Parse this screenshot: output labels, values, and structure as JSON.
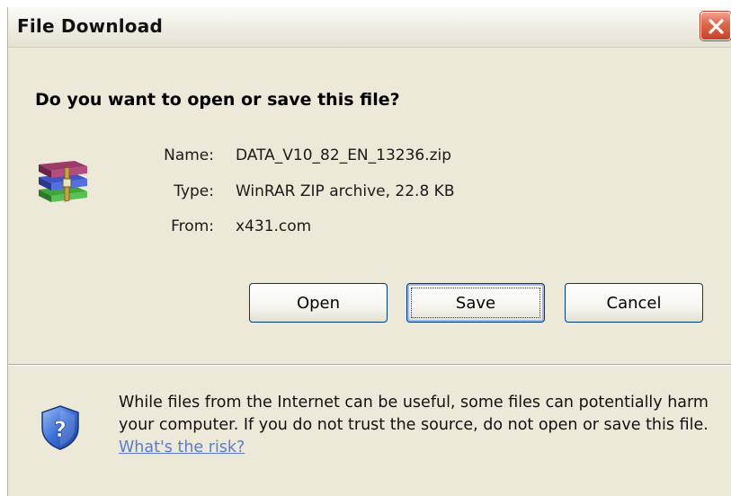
{
  "window": {
    "title": "File Download"
  },
  "question": "Do you want to open or save this file?",
  "file": {
    "name_label": "Name:",
    "name_value": "DATA_V10_82_EN_13236.zip",
    "type_label": "Type:",
    "type_value": "WinRAR ZIP archive, 22.8 KB",
    "from_label": "From:",
    "from_value": "x431.com",
    "icon": "winrar-archive-icon"
  },
  "buttons": {
    "open": "Open",
    "save": "Save",
    "cancel": "Cancel"
  },
  "warning": {
    "text": "While files from the Internet can be useful, some files can potentially harm your computer. If you do not trust the source, do not open or save this file.",
    "link": "What's the risk?",
    "icon": "security-shield-icon"
  },
  "colors": {
    "dialog_bg": "#ece9d8",
    "close_button": "#d9593a",
    "link": "#5b7bd1",
    "button_border": "#003c74"
  }
}
